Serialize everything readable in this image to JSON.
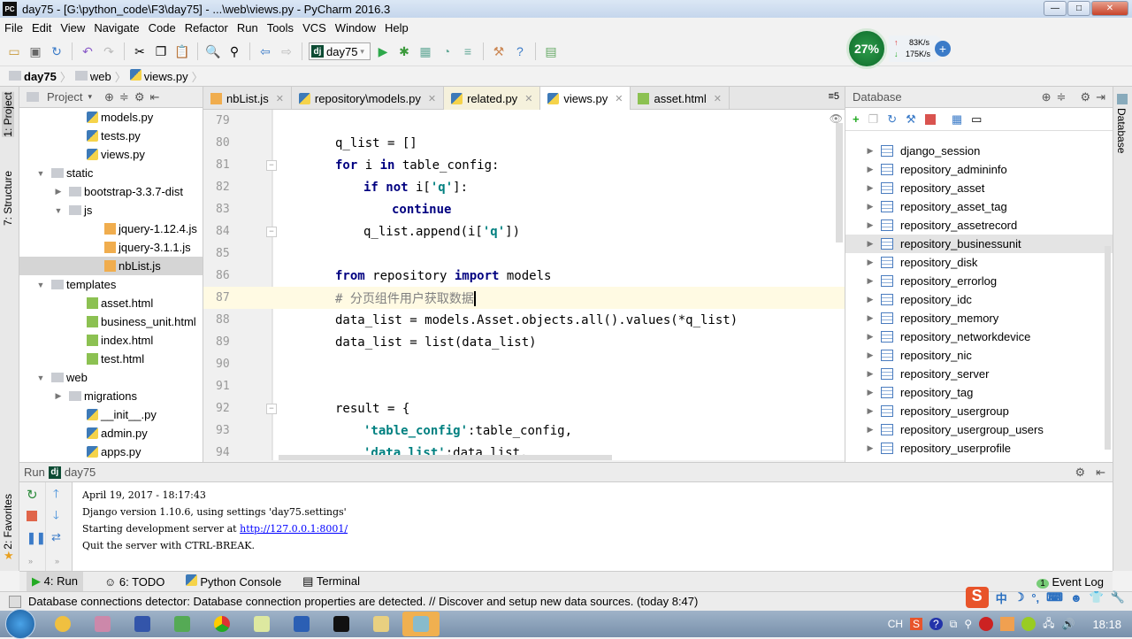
{
  "window": {
    "title": "day75 - [G:\\python_code\\F3\\day75] - ...\\web\\views.py - PyCharm 2016.3",
    "app_icon": "PC",
    "buttons": [
      "minimize",
      "maximize",
      "close"
    ]
  },
  "menu": [
    "File",
    "Edit",
    "View",
    "Navigate",
    "Code",
    "Refactor",
    "Run",
    "Tools",
    "VCS",
    "Window",
    "Help"
  ],
  "toolbar": {
    "run_config": "day75"
  },
  "net_widget": {
    "cpu": "27%",
    "up": "83K/s",
    "down": "175K/s"
  },
  "breadcrumb": [
    "day75",
    "web",
    "views.py"
  ],
  "left_stripe": {
    "project": "1: Project",
    "structure": "7: Structure",
    "favorites": "2: Favorites"
  },
  "right_stripe": {
    "database": "Database"
  },
  "project": {
    "title": "Project",
    "items": [
      {
        "label": "models.py",
        "indent": 3,
        "icon": "py"
      },
      {
        "label": "tests.py",
        "indent": 3,
        "icon": "py"
      },
      {
        "label": "views.py",
        "indent": 3,
        "icon": "py"
      },
      {
        "label": "static",
        "indent": 1,
        "icon": "folder",
        "arrow": "down"
      },
      {
        "label": "bootstrap-3.3.7-dist",
        "indent": 2,
        "icon": "folder",
        "arrow": "right"
      },
      {
        "label": "js",
        "indent": 2,
        "icon": "folder",
        "arrow": "down"
      },
      {
        "label": "jquery-1.12.4.js",
        "indent": 4,
        "icon": "js"
      },
      {
        "label": "jquery-3.1.1.js",
        "indent": 4,
        "icon": "js"
      },
      {
        "label": "nbList.js",
        "indent": 4,
        "icon": "js",
        "selected": true
      },
      {
        "label": "templates",
        "indent": 1,
        "icon": "folder",
        "arrow": "down"
      },
      {
        "label": "asset.html",
        "indent": 3,
        "icon": "html"
      },
      {
        "label": "business_unit.html",
        "indent": 3,
        "icon": "html"
      },
      {
        "label": "index.html",
        "indent": 3,
        "icon": "html"
      },
      {
        "label": "test.html",
        "indent": 3,
        "icon": "html"
      },
      {
        "label": "web",
        "indent": 1,
        "icon": "folder",
        "arrow": "down"
      },
      {
        "label": "migrations",
        "indent": 2,
        "icon": "folder",
        "arrow": "right"
      },
      {
        "label": "__init__.py",
        "indent": 3,
        "icon": "py"
      },
      {
        "label": "admin.py",
        "indent": 3,
        "icon": "py"
      },
      {
        "label": "apps.py",
        "indent": 3,
        "icon": "py"
      }
    ]
  },
  "tabs": [
    {
      "label": "nbList.js",
      "icon": "js"
    },
    {
      "label": "repository\\models.py",
      "icon": "py"
    },
    {
      "label": "related.py",
      "icon": "py",
      "modified": true
    },
    {
      "label": "views.py",
      "icon": "py",
      "active": true
    },
    {
      "label": "asset.html",
      "icon": "html"
    }
  ],
  "tabs_overflow": "5",
  "editor": {
    "lines": [
      {
        "n": "79",
        "indent": 0,
        "tokens": []
      },
      {
        "n": "80",
        "indent": 8,
        "tokens": [
          {
            "t": "q_list = []"
          }
        ]
      },
      {
        "n": "81",
        "indent": 8,
        "tokens": [
          {
            "t": "for",
            "c": "kw"
          },
          {
            "t": " i "
          },
          {
            "t": "in",
            "c": "kw"
          },
          {
            "t": " table_config:"
          }
        ]
      },
      {
        "n": "82",
        "indent": 12,
        "tokens": [
          {
            "t": "if not",
            "c": "kw"
          },
          {
            "t": " i["
          },
          {
            "t": "'q'",
            "c": "str"
          },
          {
            "t": "]:"
          }
        ]
      },
      {
        "n": "83",
        "indent": 16,
        "tokens": [
          {
            "t": "continue",
            "c": "kw"
          }
        ]
      },
      {
        "n": "84",
        "indent": 12,
        "tokens": [
          {
            "t": "q_list.append(i["
          },
          {
            "t": "'q'",
            "c": "str"
          },
          {
            "t": "])"
          }
        ]
      },
      {
        "n": "85",
        "indent": 0,
        "tokens": []
      },
      {
        "n": "86",
        "indent": 8,
        "tokens": [
          {
            "t": "from",
            "c": "kw"
          },
          {
            "t": " repository "
          },
          {
            "t": "import",
            "c": "kw"
          },
          {
            "t": " models"
          }
        ]
      },
      {
        "n": "87",
        "indent": 8,
        "current": true,
        "tokens": [
          {
            "t": "# 分页组件用户获取数据",
            "c": "cm"
          }
        ]
      },
      {
        "n": "88",
        "indent": 8,
        "tokens": [
          {
            "t": "data_list = models.Asset.objects.all().values(*q_list)"
          }
        ]
      },
      {
        "n": "89",
        "indent": 8,
        "tokens": [
          {
            "t": "data_list = list(data_list)"
          }
        ]
      },
      {
        "n": "90",
        "indent": 0,
        "tokens": []
      },
      {
        "n": "91",
        "indent": 0,
        "tokens": []
      },
      {
        "n": "92",
        "indent": 8,
        "tokens": [
          {
            "t": "result = {"
          }
        ]
      },
      {
        "n": "93",
        "indent": 12,
        "tokens": [
          {
            "t": "'table_config'",
            "c": "str"
          },
          {
            "t": ":table_config,"
          }
        ]
      },
      {
        "n": "94",
        "indent": 12,
        "tokens": [
          {
            "t": "'data_list'",
            "c": "str"
          },
          {
            "t": ":data_list,"
          }
        ]
      }
    ]
  },
  "database": {
    "title": "Database",
    "items": [
      "django_session",
      "repository_admininfo",
      "repository_asset",
      "repository_asset_tag",
      "repository_assetrecord",
      "repository_businessunit",
      "repository_disk",
      "repository_errorlog",
      "repository_idc",
      "repository_memory",
      "repository_networkdevice",
      "repository_nic",
      "repository_server",
      "repository_tag",
      "repository_usergroup",
      "repository_usergroup_users",
      "repository_userprofile"
    ],
    "selected": "repository_businessunit"
  },
  "run": {
    "label": "Run",
    "config": "day75",
    "output": [
      "April 19, 2017 - 18:17:43",
      "Django version 1.10.6, using settings 'day75.settings'",
      "Starting development server at ",
      "Quit the server with CTRL-BREAK."
    ],
    "link": "http://127.0.0.1:8001/"
  },
  "bottom_tabs": [
    "4: Run",
    "6: TODO",
    "Python Console",
    "Terminal"
  ],
  "event_log": {
    "label": "Event Log",
    "count": "1"
  },
  "status": "Database connections detector: Database connection properties are detected. // Discover and setup new data sources. (today 8:47)",
  "taskbar": {
    "lang": "CH",
    "clock": "18:18",
    "ime": "中"
  }
}
